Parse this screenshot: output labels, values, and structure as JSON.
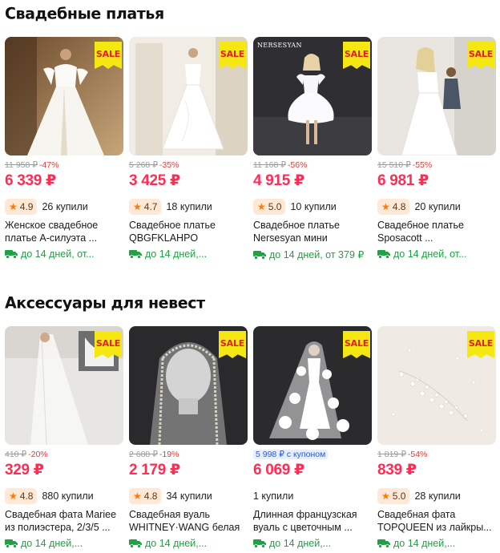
{
  "sections": [
    {
      "title": "Свадебные платья",
      "cards": [
        {
          "image": "white-wedding-dress-photo",
          "sale": "SALE",
          "brand": "",
          "old_price": "11 958 ₽",
          "discount": "-47%",
          "coupon": "",
          "price": "6 339 ₽",
          "rating": "4.9",
          "sold": "26 купили",
          "title": "Женское свадебное платье А-силуэта ...",
          "delivery": "до 14 дней, от..."
        },
        {
          "image": "white-wedding-dress-photo",
          "sale": "SALE",
          "brand": "",
          "old_price": "5 268 ₽",
          "discount": "-35%",
          "coupon": "",
          "price": "3 425 ₽",
          "rating": "4.7",
          "sold": "18 купили",
          "title": "Свадебное платье QBGFKLAHPO",
          "delivery": "до 14 дней,..."
        },
        {
          "image": "white-mini-dress-photo",
          "sale": "SALE",
          "brand": "NERSESYAN",
          "old_price": "11 168 ₽",
          "discount": "-56%",
          "coupon": "",
          "price": "4 915 ₽",
          "rating": "5.0",
          "sold": "10 купили",
          "title": "Свадебное платье Nersesyan мини",
          "delivery": "до 14 дней, от 379 ₽"
        },
        {
          "image": "white-wedding-dress-photo",
          "sale": "SALE",
          "brand": "",
          "old_price": "15 510 ₽",
          "discount": "-55%",
          "coupon": "",
          "price": "6 981 ₽",
          "rating": "4.8",
          "sold": "20 купили",
          "title": "Свадебное платье Sposacott ...",
          "delivery": "до 14 дней, от..."
        }
      ]
    },
    {
      "title": "Аксессуары для невест",
      "cards": [
        {
          "image": "bridal-veil-photo",
          "sale": "SALE",
          "brand": "",
          "old_price": "410 ₽",
          "discount": "-20%",
          "coupon": "",
          "price": "329 ₽",
          "rating": "4.8",
          "sold": "880 купили",
          "title": "Свадебная фата Mariee из полиэстера, 2/3/5 ...",
          "delivery": "до 14 дней,..."
        },
        {
          "image": "beaded-veil-photo",
          "sale": "SALE",
          "brand": "",
          "old_price": "2 688 ₽",
          "discount": "-19%",
          "coupon": "",
          "price": "2 179 ₽",
          "rating": "4.8",
          "sold": "34 купили",
          "title": "Свадебная вуаль WHITNEY·WANG белая",
          "delivery": "до 14 дней,..."
        },
        {
          "image": "floral-veil-photo",
          "sale": "SALE",
          "brand": "",
          "old_price": "",
          "discount": "",
          "coupon": "5 998 ₽ с купоном",
          "price": "6 069 ₽",
          "rating": "",
          "sold": "1 купили",
          "title": "Длинная французская вуаль с цветочным ...",
          "delivery": "до 14 дней,..."
        },
        {
          "image": "pearl-veil-photo",
          "sale": "SALE",
          "brand": "",
          "old_price": "1 819 ₽",
          "discount": "-54%",
          "coupon": "",
          "price": "839 ₽",
          "rating": "5.0",
          "sold": "28 купили",
          "title": "Свадебная фата TOPQUEEN из лайкры...",
          "delivery": "до 14 дней,..."
        }
      ]
    }
  ],
  "colors": {
    "price": "#ff2d55",
    "sale_bg": "#f5e812",
    "sale_text": "#e02020",
    "delivery": "#22a045",
    "rating_bg": "#ffe8d6",
    "star": "#ff7a00"
  }
}
